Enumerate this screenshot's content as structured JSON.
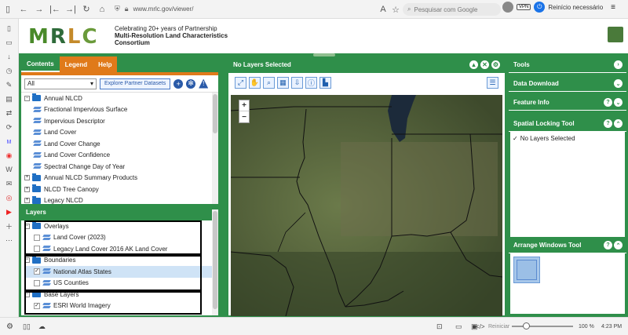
{
  "browser": {
    "url": "www.mrlc.gov/viewer/",
    "search_placeholder": "Pesquisar com Google",
    "vpn_label": "VPN",
    "restart_label": "Reinício necessário",
    "reset_label": "Reiniciar",
    "zoom_level": "100 %",
    "time": "4:23 PM"
  },
  "header": {
    "logo_letters": [
      "M",
      "R",
      "L",
      "C"
    ],
    "tagline_line1": "Celebrating 20+ years of Partnership",
    "tagline_line2": "Multi-Resolution Land Characteristics",
    "tagline_line3": "Consortium"
  },
  "left_panel": {
    "tabs": [
      "Contents",
      "Legend",
      "Help"
    ],
    "filter_value": "All",
    "explore_button": "Explore Partner Datasets",
    "catalog": [
      {
        "label": "Annual NLCD",
        "type": "folder",
        "expanded": true,
        "level": 0
      },
      {
        "label": "Fractional Impervious Surface",
        "type": "layer",
        "level": 1
      },
      {
        "label": "Impervious Descriptor",
        "type": "layer",
        "level": 1
      },
      {
        "label": "Land Cover",
        "type": "layer",
        "level": 1
      },
      {
        "label": "Land Cover Change",
        "type": "layer",
        "level": 1
      },
      {
        "label": "Land Cover Confidence",
        "type": "layer",
        "level": 1
      },
      {
        "label": "Spectral Change Day of Year",
        "type": "layer",
        "level": 1
      },
      {
        "label": "Annual NLCD Summary Products",
        "type": "folder",
        "expanded": false,
        "level": 0
      },
      {
        "label": "NLCD Tree Canopy",
        "type": "folder",
        "expanded": false,
        "level": 0
      },
      {
        "label": "Legacy NLCD",
        "type": "folder",
        "expanded": false,
        "level": 0
      }
    ],
    "layers_title": "Layers",
    "layers": [
      {
        "label": "Overlays",
        "type": "folder",
        "level": 0
      },
      {
        "label": "Land Cover (2023)",
        "type": "layer",
        "checked": false,
        "level": 1
      },
      {
        "label": "Legacy Land Cover 2016 AK Land Cover",
        "type": "layer",
        "checked": false,
        "level": 1
      },
      {
        "label": "Boundaries",
        "type": "folder",
        "level": 0
      },
      {
        "label": "National Atlas States",
        "type": "layer",
        "checked": true,
        "level": 1,
        "selected": true
      },
      {
        "label": "US Counties",
        "type": "layer",
        "checked": false,
        "level": 1
      },
      {
        "label": "Base Layers",
        "type": "folder",
        "level": 0
      },
      {
        "label": "ESRI World Imagery",
        "type": "layer",
        "checked": true,
        "level": 1
      }
    ]
  },
  "map": {
    "title": "No Layers Selected",
    "zoom_in": "+",
    "zoom_out": "−"
  },
  "right_panel": {
    "tools_title": "Tools",
    "data_download_title": "Data Download",
    "feature_info_title": "Feature Info",
    "spatial_locking_title": "Spatial Locking Tool",
    "spatial_locking_status": "No Layers Selected",
    "arrange_windows_title": "Arrange Windows Tool"
  }
}
